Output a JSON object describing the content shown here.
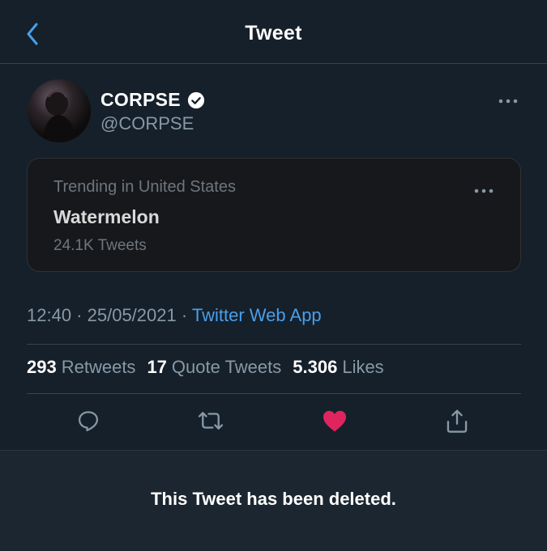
{
  "header": {
    "title": "Tweet",
    "back_icon": "chevron-left-icon"
  },
  "author": {
    "display_name": "CORPSE",
    "handle": "@CORPSE",
    "verified": true
  },
  "trend_card": {
    "subtitle": "Trending in United States",
    "title": "Watermelon",
    "count": "24.1K Tweets"
  },
  "meta": {
    "time": "12:40",
    "separator": " · ",
    "date": "25/05/2021",
    "separator2": " · ",
    "source": "Twitter Web App"
  },
  "stats": {
    "retweets_count": "293",
    "retweets_label": "Retweets",
    "quotes_count": "17",
    "quotes_label": "Quote Tweets",
    "likes_count": "5.306",
    "likes_label": "Likes"
  },
  "actions": [
    "reply-icon",
    "retweet-icon",
    "like-icon",
    "share-icon"
  ],
  "colors": {
    "background": "#15202b",
    "accent": "#4a9ee8",
    "like": "#e0245e",
    "muted": "#8899a6"
  },
  "deleted_notice": "This Tweet has been deleted."
}
